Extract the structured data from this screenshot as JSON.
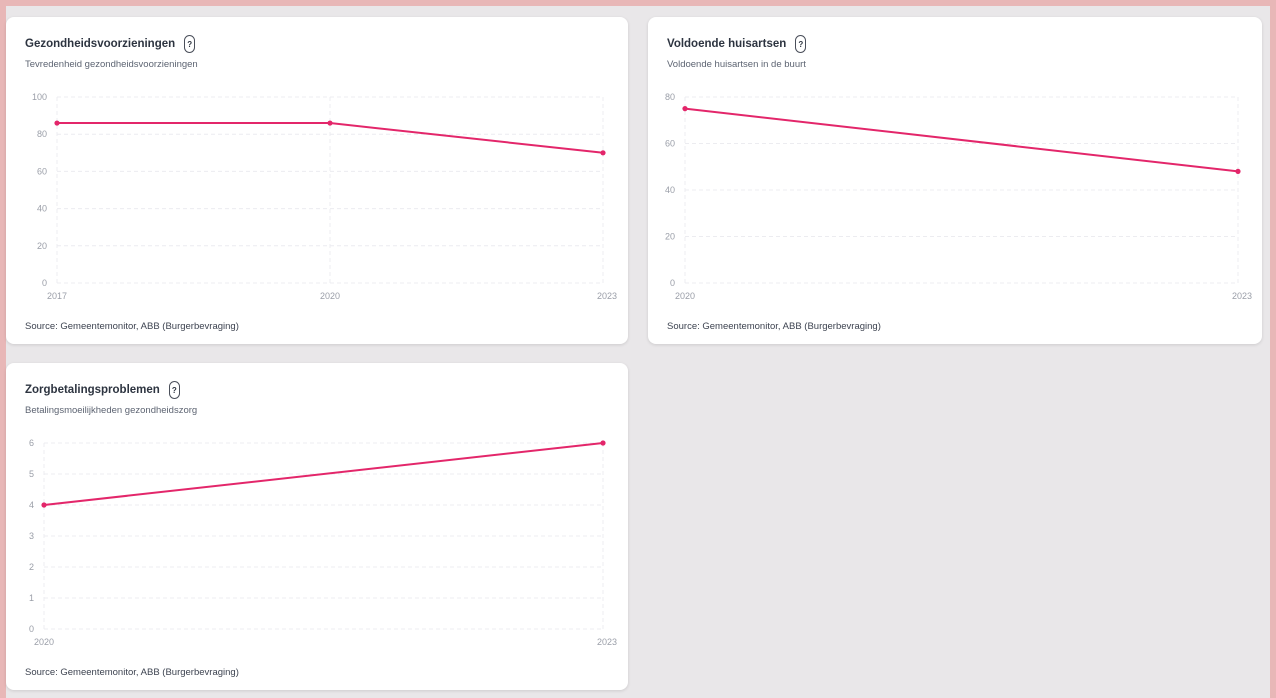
{
  "colors": {
    "line": "#e3266a",
    "background": "#e9e7e9",
    "card": "#ffffff",
    "border_accent": "#e8b7b7"
  },
  "cards": [
    {
      "title": "Gezondheidsvoorzieningen",
      "subtitle": "Tevredenheid gezondheidsvoorzieningen",
      "help_label": "?",
      "source": "Source: Gemeentemonitor, ABB (Burgerbevraging)"
    },
    {
      "title": "Voldoende huisartsen",
      "subtitle": "Voldoende huisartsen in de buurt",
      "help_label": "?",
      "source": "Source: Gemeentemonitor, ABB (Burgerbevraging)"
    },
    {
      "title": "Zorgbetalingsproblemen",
      "subtitle": "Betalingsmoeilijkheden gezondheidszorg",
      "help_label": "?",
      "source": "Source: Gemeentemonitor, ABB (Burgerbevraging)"
    }
  ],
  "chart_data": [
    {
      "type": "line",
      "x": [
        "2017",
        "2020",
        "2023"
      ],
      "series": [
        {
          "values": [
            86,
            86,
            70
          ]
        }
      ],
      "ylim": [
        0,
        100
      ],
      "yticks": [
        0,
        20,
        40,
        60,
        80,
        100
      ],
      "grid": true
    },
    {
      "type": "line",
      "x": [
        "2020",
        "2023"
      ],
      "series": [
        {
          "values": [
            75,
            48
          ]
        }
      ],
      "ylim": [
        0,
        80
      ],
      "yticks": [
        0,
        20,
        40,
        60,
        80
      ],
      "grid": true
    },
    {
      "type": "line",
      "x": [
        "2020",
        "2023"
      ],
      "series": [
        {
          "values": [
            4,
            6
          ]
        }
      ],
      "ylim": [
        0,
        6
      ],
      "yticks": [
        0,
        1,
        2,
        3,
        4,
        5,
        6
      ],
      "grid": true
    }
  ]
}
